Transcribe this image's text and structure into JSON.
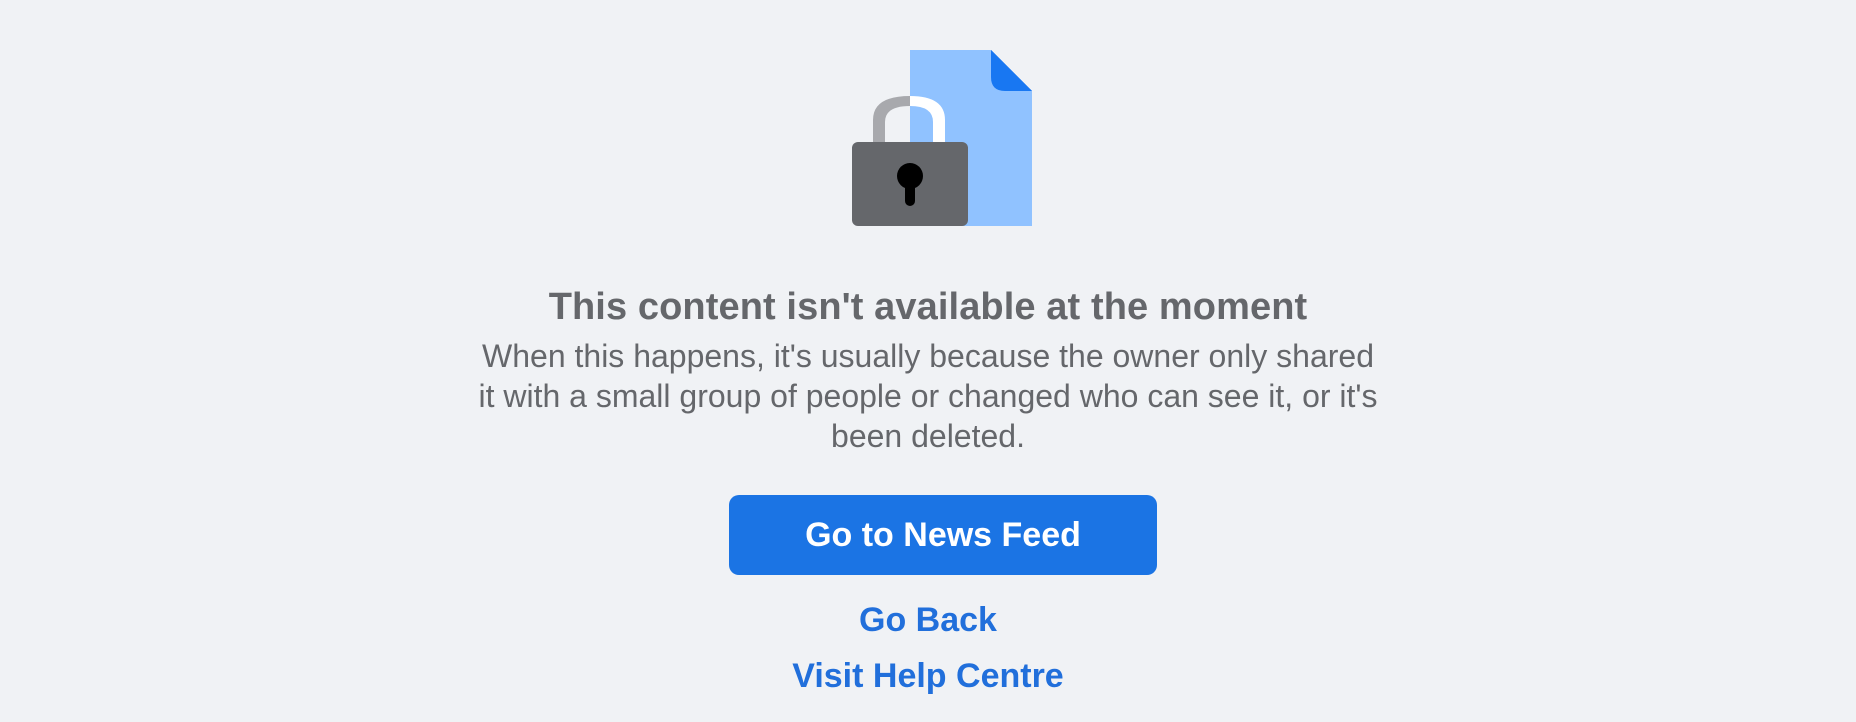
{
  "notice": {
    "title": "This content isn't available at the moment",
    "description": "When this happens, it's usually because the owner only shared it with a small group of people or changed who can see it, or it's been deleted."
  },
  "actions": {
    "primary_label": "Go to News Feed",
    "go_back_label": "Go Back",
    "help_label": "Visit Help Centre"
  },
  "illustration": {
    "icons": [
      "lock-icon",
      "document-icon"
    ],
    "colors": {
      "document": "#90c2ff",
      "document_fold": "#1877f2",
      "lock_body": "#65676b",
      "lock_shackle": "#a8a9ad",
      "keyhole": "#000000"
    }
  },
  "colors": {
    "background": "#f0f2f5",
    "text_secondary": "#65676b",
    "button_primary": "#1b74e4",
    "link": "#216fdb"
  }
}
